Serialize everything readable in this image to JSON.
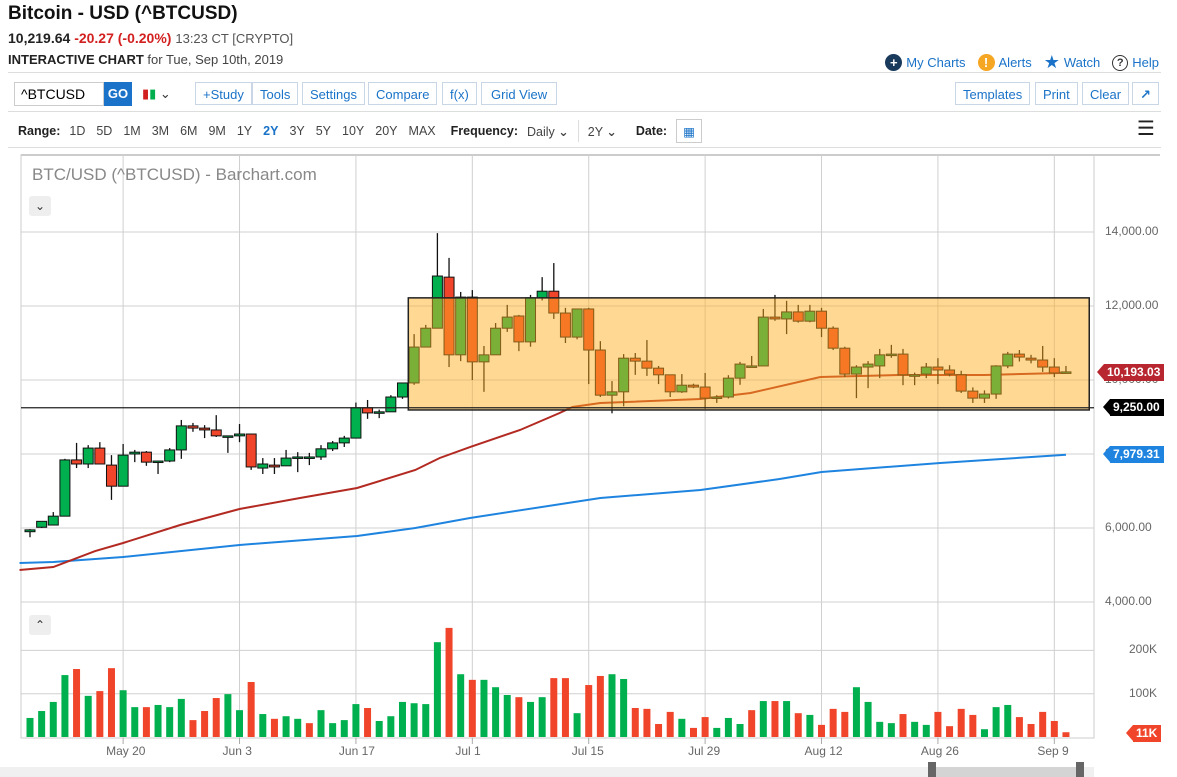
{
  "header": {
    "title": "Bitcoin - USD (^BTCUSD)",
    "last": "10,219.64",
    "change": "-20.27 (-0.20%)",
    "time": "13:23 CT [CRYPTO]",
    "subtitle_bold": "INTERACTIVE CHART",
    "subtitle_rest": "for Tue, Sep 10th, 2019"
  },
  "top_links": {
    "my_charts": "My Charts",
    "alerts": "Alerts",
    "watch": "Watch",
    "help": "Help"
  },
  "toolbar": {
    "symbol_value": "^BTCUSD",
    "go": "GO",
    "study": "+Study",
    "tools": "Tools",
    "settings": "Settings",
    "compare": "Compare",
    "fx": "f(x)",
    "grid_view": "Grid View",
    "templates": "Templates",
    "print": "Print",
    "clear": "Clear",
    "popout": "↗"
  },
  "range_bar": {
    "range_label": "Range:",
    "ranges": [
      "1D",
      "5D",
      "1M",
      "3M",
      "6M",
      "9M",
      "1Y",
      "2Y",
      "3Y",
      "5Y",
      "10Y",
      "20Y",
      "MAX"
    ],
    "active_range": "2Y",
    "frequency_label": "Frequency:",
    "frequency": "Daily",
    "period": "2Y",
    "date_label": "Date:"
  },
  "colors": {
    "up": "#00b04f",
    "down": "#f0452a",
    "ma_fast": "#b22a22",
    "ma_slow": "#1e84e0",
    "box": "#ffb020",
    "accent": "#1a73c8"
  },
  "chart_data": {
    "type": "candlestick",
    "title": "BTC/USD (^BTCUSD) - Barchart.com",
    "y_ticks": [
      "14,000.00",
      "12,000.00",
      "10,000.00",
      "8,000.00",
      "6,000.00",
      "4,000.00"
    ],
    "y_tick_values": [
      14000,
      12000,
      10000,
      8000,
      6000,
      4000
    ],
    "ylim": [
      4000,
      14000
    ],
    "x_ticks": [
      {
        "label": "May 20",
        "index": 8
      },
      {
        "label": "Jun 3",
        "index": 18
      },
      {
        "label": "Jun 17",
        "index": 28
      },
      {
        "label": "Jul 1",
        "index": 38
      },
      {
        "label": "Jul 15",
        "index": 48
      },
      {
        "label": "Jul 29",
        "index": 58
      },
      {
        "label": "Aug 12",
        "index": 68
      },
      {
        "label": "Aug 26",
        "index": 78
      },
      {
        "label": "Sep 9",
        "index": 88
      }
    ],
    "ohlc": [
      [
        5900,
        5970,
        5750,
        5950
      ],
      [
        6020,
        6180,
        6000,
        6180
      ],
      [
        6080,
        6430,
        6080,
        6320
      ],
      [
        6320,
        7870,
        6320,
        7840
      ],
      [
        7840,
        8300,
        7620,
        7730
      ],
      [
        7730,
        8240,
        7620,
        8160
      ],
      [
        8160,
        8320,
        7730,
        7730
      ],
      [
        7700,
        7970,
        6760,
        7130
      ],
      [
        7130,
        8270,
        7130,
        7970
      ],
      [
        8000,
        8110,
        7780,
        8050
      ],
      [
        8050,
        8080,
        7680,
        7780
      ],
      [
        7810,
        7810,
        7460,
        7810
      ],
      [
        7810,
        8160,
        7780,
        8110
      ],
      [
        8110,
        8920,
        7870,
        8760
      ],
      [
        8760,
        8840,
        8600,
        8700
      ],
      [
        8700,
        8780,
        8430,
        8650
      ],
      [
        8650,
        9050,
        8460,
        8490
      ],
      [
        8490,
        8490,
        8030,
        8490
      ],
      [
        8490,
        8810,
        8320,
        8540
      ],
      [
        8540,
        8540,
        7570,
        7650
      ],
      [
        7620,
        7890,
        7460,
        7730
      ],
      [
        7700,
        7890,
        7460,
        7650
      ],
      [
        7680,
        8110,
        7680,
        7890
      ],
      [
        7890,
        8050,
        7510,
        7920
      ],
      [
        7920,
        8030,
        7700,
        7920
      ],
      [
        7920,
        8240,
        7840,
        8140
      ],
      [
        8140,
        8350,
        8080,
        8300
      ],
      [
        8300,
        8490,
        8190,
        8430
      ],
      [
        8430,
        9390,
        8430,
        9250
      ],
      [
        9250,
        9460,
        8950,
        9110
      ],
      [
        9110,
        9200,
        8970,
        9140
      ],
      [
        9140,
        9590,
        9140,
        9540
      ],
      [
        9540,
        9920,
        9490,
        9920
      ],
      [
        9920,
        11240,
        9870,
        10890
      ],
      [
        10890,
        11490,
        10890,
        11400
      ],
      [
        11400,
        13970,
        11400,
        12810
      ],
      [
        12780,
        13300,
        10350,
        10680
      ],
      [
        10680,
        12380,
        10510,
        12240
      ],
      [
        12240,
        12430,
        10000,
        10490
      ],
      [
        10490,
        10920,
        9680,
        10680
      ],
      [
        10680,
        11540,
        10680,
        11400
      ],
      [
        11400,
        12030,
        11300,
        11700
      ],
      [
        11730,
        11760,
        10780,
        11030
      ],
      [
        11030,
        12300,
        10900,
        12220
      ],
      [
        12220,
        12780,
        12150,
        12400
      ],
      [
        12400,
        13160,
        11650,
        11810
      ],
      [
        11810,
        11950,
        11000,
        11160
      ],
      [
        11160,
        11920,
        11100,
        11920
      ],
      [
        11920,
        11950,
        9890,
        10810
      ],
      [
        10810,
        11050,
        9540,
        9590
      ],
      [
        9590,
        9970,
        9100,
        9680
      ],
      [
        9680,
        10700,
        9290,
        10590
      ],
      [
        10590,
        10730,
        10140,
        10510
      ],
      [
        10510,
        11080,
        10110,
        10320
      ],
      [
        10320,
        10380,
        9890,
        10140
      ],
      [
        10140,
        10140,
        9540,
        9680
      ],
      [
        9680,
        10160,
        9650,
        9860
      ],
      [
        9860,
        9900,
        9780,
        9810
      ],
      [
        9810,
        10190,
        9220,
        9510
      ],
      [
        9540,
        9590,
        9380,
        9540
      ],
      [
        9540,
        10130,
        9500,
        10050
      ],
      [
        10050,
        10490,
        9870,
        10430
      ],
      [
        10380,
        10650,
        10350,
        10380
      ],
      [
        10380,
        11920,
        10380,
        11700
      ],
      [
        11700,
        12300,
        11600,
        11650
      ],
      [
        11650,
        12140,
        11240,
        11840
      ],
      [
        11840,
        12030,
        11550,
        11590
      ],
      [
        11590,
        12030,
        11560,
        11860
      ],
      [
        11860,
        11950,
        11160,
        11400
      ],
      [
        11400,
        11450,
        10810,
        10860
      ],
      [
        10860,
        10900,
        10080,
        10160
      ],
      [
        10160,
        10400,
        9510,
        10350
      ],
      [
        10350,
        10510,
        9780,
        10430
      ],
      [
        10380,
        10840,
        10050,
        10680
      ],
      [
        10700,
        10950,
        10600,
        10700
      ],
      [
        10700,
        10840,
        9860,
        10140
      ],
      [
        10140,
        10200,
        9860,
        10140
      ],
      [
        10160,
        10460,
        10050,
        10350
      ],
      [
        10350,
        10590,
        9890,
        10270
      ],
      [
        10270,
        10400,
        10100,
        10160
      ],
      [
        10140,
        10250,
        9650,
        9700
      ],
      [
        9700,
        9800,
        9380,
        9510
      ],
      [
        9510,
        9720,
        9380,
        9620
      ],
      [
        9620,
        10400,
        9490,
        10380
      ],
      [
        10380,
        10760,
        10320,
        10700
      ],
      [
        10700,
        10810,
        10500,
        10620
      ],
      [
        10590,
        10680,
        10450,
        10540
      ],
      [
        10540,
        10920,
        10220,
        10350
      ],
      [
        10350,
        10590,
        10080,
        10190
      ],
      [
        10219,
        10380,
        10200,
        10219
      ]
    ],
    "ma_fast": [
      [
        -0.9,
        4865
      ],
      [
        2,
        4946
      ],
      [
        5.6,
        5378
      ],
      [
        8,
        5595
      ],
      [
        12.9,
        6081
      ],
      [
        18,
        6514
      ],
      [
        23.2,
        6811
      ],
      [
        28.1,
        7081
      ],
      [
        33.1,
        7568
      ],
      [
        35.2,
        7892
      ],
      [
        37.8,
        8189
      ],
      [
        42.1,
        8649
      ],
      [
        45.5,
        9108
      ],
      [
        46.6,
        9270
      ],
      [
        49,
        9378
      ],
      [
        57.6,
        9486
      ],
      [
        61.9,
        9649
      ],
      [
        67.9,
        10081
      ],
      [
        74.7,
        10135
      ],
      [
        82,
        10135
      ],
      [
        89,
        10193
      ]
    ],
    "ma_slow": [
      [
        -0.9,
        5054
      ],
      [
        2,
        5081
      ],
      [
        8,
        5216
      ],
      [
        18,
        5541
      ],
      [
        28.1,
        5784
      ],
      [
        33.1,
        6000
      ],
      [
        37.8,
        6270
      ],
      [
        49,
        6811
      ],
      [
        57.6,
        7027
      ],
      [
        64.4,
        7324
      ],
      [
        68,
        7514
      ],
      [
        78.2,
        7757
      ],
      [
        89,
        7979
      ]
    ],
    "box": {
      "from_index": 32.5,
      "to_index": 91,
      "top": 12220,
      "bottom": 9190
    },
    "support_line": 9250,
    "tags": {
      "last_ma": "10,193.03",
      "support": "9,250.00",
      "slow_ma": "7,979.31",
      "volume": "11K"
    },
    "volume": {
      "y_ticks": [
        "200K",
        "100K"
      ],
      "y_tick_values": [
        200,
        100
      ],
      "values_k": [
        44,
        60,
        81,
        143,
        157,
        95,
        106,
        159,
        108,
        69,
        69,
        74,
        69,
        88,
        39,
        60,
        90,
        99,
        62,
        127,
        53,
        42,
        48,
        42,
        32,
        62,
        32,
        39,
        76,
        67,
        37,
        48,
        81,
        78,
        76,
        219,
        252,
        145,
        132,
        132,
        115,
        97,
        92,
        81,
        92,
        136,
        136,
        55,
        120,
        141,
        145,
        134,
        67,
        65,
        30,
        58,
        42,
        21,
        46,
        21,
        44,
        30,
        62,
        83,
        83,
        83,
        55,
        51,
        28,
        65,
        58,
        115,
        81,
        35,
        32,
        53,
        35,
        28,
        58,
        25,
        65,
        51,
        18,
        69,
        74,
        46,
        30,
        58,
        37,
        11
      ],
      "up": "GGGGRGRRGGRGGGRRRGGRGRGGRGGGGRGGGGGGRGRGGGRGGRRGRRGGRRRRGRRGGGRGRGRGRRRGGGGRGGRRRRGGGRRRRR"
    }
  }
}
